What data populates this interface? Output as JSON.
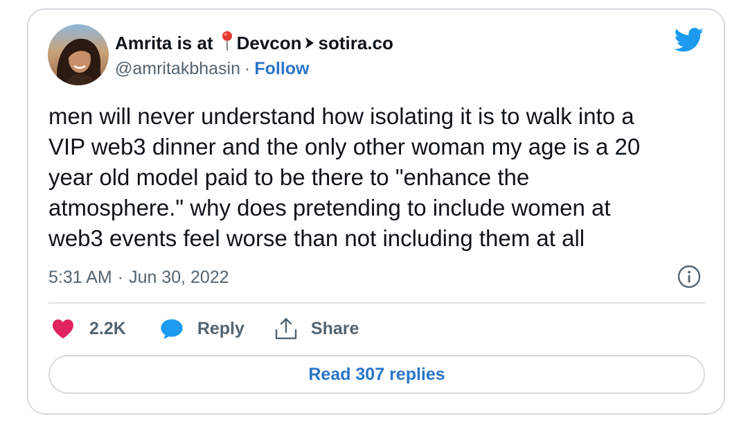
{
  "author": {
    "name_prefix": "Amrita is at",
    "name_middle": "Devcon",
    "name_suffix": "sotira.co",
    "handle": "@amritakbhasin",
    "separator": "·",
    "follow_label": "Follow",
    "pin_icon": "round-pushpin-icon",
    "arrow_icon": "arrow-pointer-icon"
  },
  "tweet": {
    "lines": [
      "men will never understand how isolating it is to walk into a",
      "VIP web3 dinner and the only other woman my age is a 20",
      "year old model paid to be there to \"enhance the",
      "atmosphere.\" why does pretending to include women at",
      "web3 events feel worse than not including them at all"
    ],
    "time": "5:31 AM",
    "separator": "·",
    "date": "Jun 30, 2022"
  },
  "actions": {
    "like_count": "2.2K",
    "reply_label": "Reply",
    "share_label": "Share",
    "read_replies_label": "Read 307 replies"
  },
  "colors": {
    "brand_blue": "#1d9bf0",
    "link_blue": "#2a75c9",
    "like_pink": "#e0245e",
    "pin_red": "#e53935",
    "text_primary": "#0f1419",
    "text_secondary": "#536471",
    "border": "#d6dbe0"
  },
  "icons": [
    "twitter-bird-icon",
    "info-icon",
    "heart-icon",
    "speech-bubble-icon",
    "share-upload-icon"
  ]
}
